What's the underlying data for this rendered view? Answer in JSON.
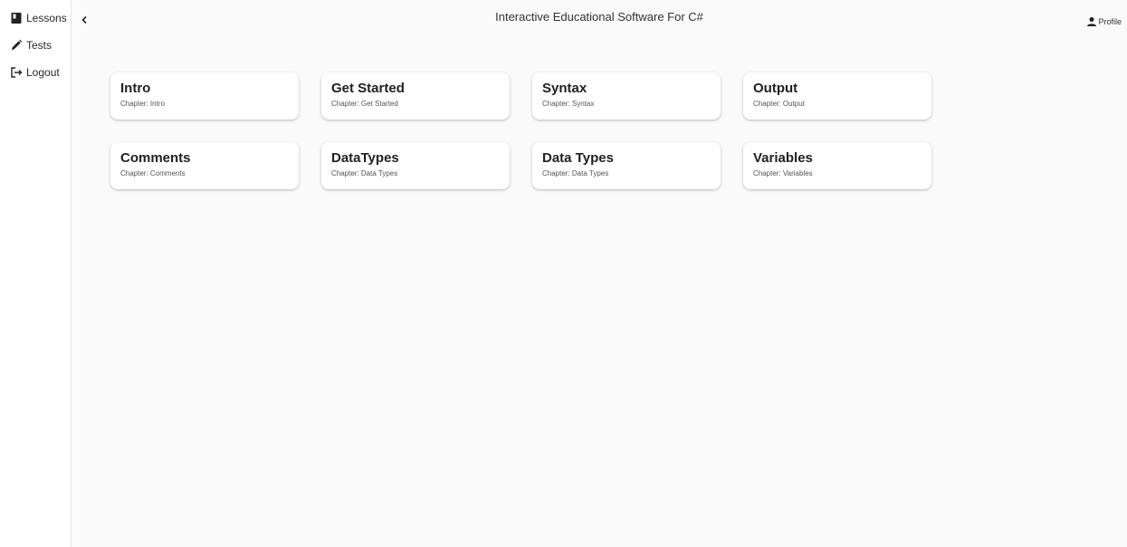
{
  "sidebar": {
    "items": [
      {
        "label": "Lessons",
        "icon": "book-icon"
      },
      {
        "label": "Tests",
        "icon": "pencil-icon"
      },
      {
        "label": "Logout",
        "icon": "logout-icon"
      }
    ]
  },
  "header": {
    "title": "Interactive Educational Software For C#",
    "profile_label": "Profile"
  },
  "lessons": [
    {
      "title": "Intro",
      "chapter": "Chapter: Intro"
    },
    {
      "title": "Get Started",
      "chapter": "Chapter: Get Started"
    },
    {
      "title": "Syntax",
      "chapter": "Chapter: Syntax"
    },
    {
      "title": "Output",
      "chapter": "Chapter: Output"
    },
    {
      "title": "Comments",
      "chapter": "Chapter: Comments"
    },
    {
      "title": "DataTypes",
      "chapter": "Chapter: Data Types"
    },
    {
      "title": "Data Types",
      "chapter": "Chapter: Data Types"
    },
    {
      "title": "Variables",
      "chapter": "Chapter: Variables"
    }
  ]
}
